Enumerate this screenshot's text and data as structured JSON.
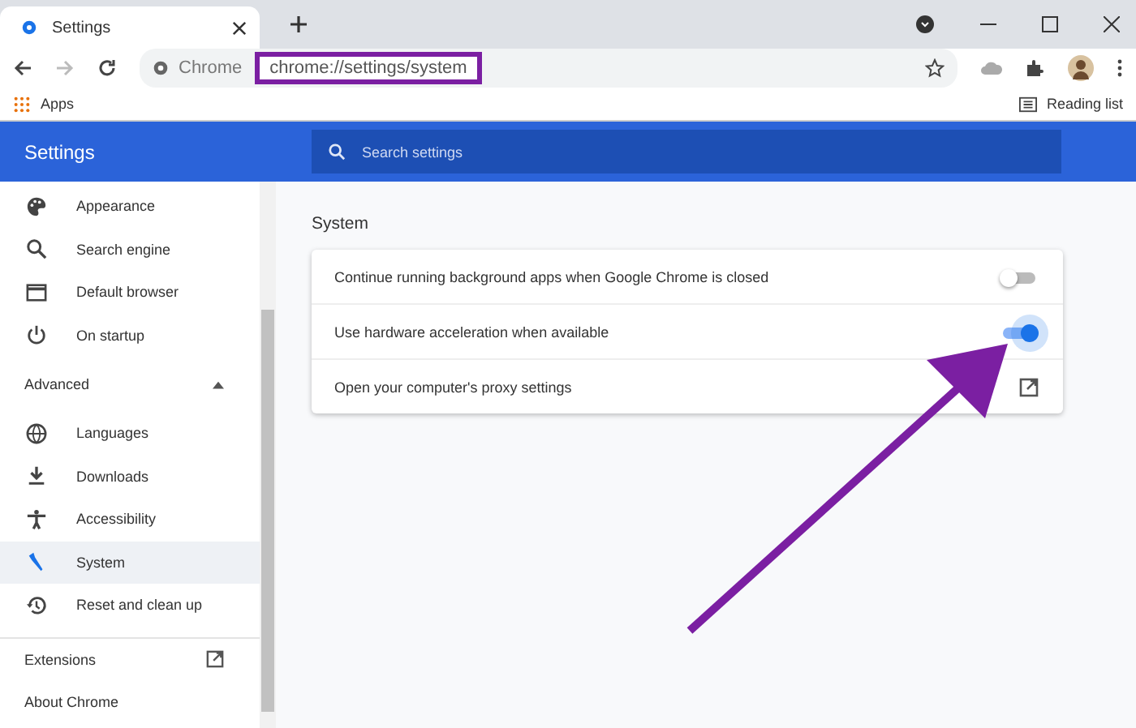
{
  "browser": {
    "tab": {
      "title": "Settings"
    },
    "omnibox": {
      "site": "Chrome",
      "url": "chrome://settings/system"
    },
    "bookmarks": [
      {
        "label": "Apps"
      }
    ],
    "reading_list": "Reading list"
  },
  "header": {
    "title": "Settings",
    "search": {
      "placeholder": "Search settings"
    }
  },
  "sidebar": {
    "items": [
      {
        "label": "Appearance",
        "selected": false
      },
      {
        "label": "Search engine",
        "selected": false
      },
      {
        "label": "Default browser",
        "selected": false
      },
      {
        "label": "On startup",
        "selected": false
      }
    ],
    "advanced": {
      "label": "Advanced",
      "expanded": true,
      "items": [
        {
          "label": "Languages",
          "selected": false
        },
        {
          "label": "Downloads",
          "selected": false
        },
        {
          "label": "Accessibility",
          "selected": false
        },
        {
          "label": "System",
          "selected": true
        },
        {
          "label": "Reset and clean up",
          "selected": false
        }
      ]
    },
    "footer": [
      {
        "label": "Extensions",
        "external": true
      },
      {
        "label": "About Chrome",
        "external": false
      }
    ]
  },
  "section": {
    "title": "System",
    "rows": [
      {
        "kind": "toggle",
        "label": "Continue running background apps when Google Chrome is closed",
        "on": false
      },
      {
        "kind": "toggle",
        "label": "Use hardware acceleration when available",
        "on": true
      },
      {
        "kind": "link",
        "label": "Open your computer's proxy settings"
      }
    ]
  }
}
